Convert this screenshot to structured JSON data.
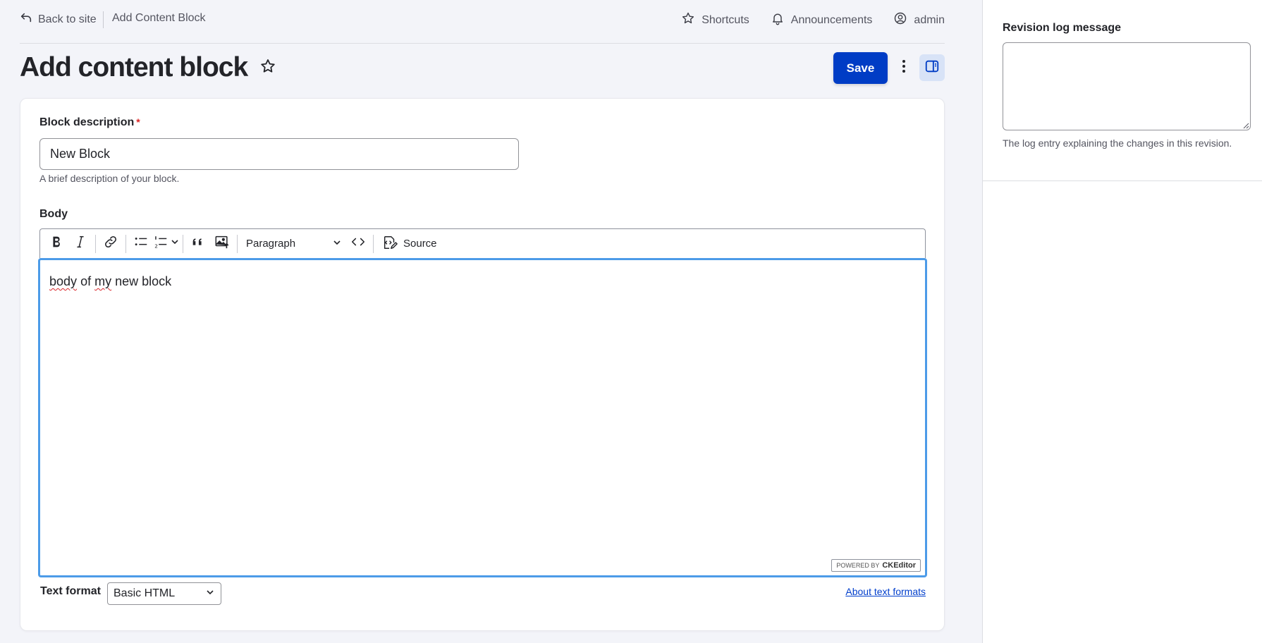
{
  "topbar": {
    "back_label": "Back to site",
    "breadcrumb": "Add Content Block",
    "shortcuts_label": "Shortcuts",
    "announcements_label": "Announcements",
    "user_label": "admin"
  },
  "page": {
    "title": "Add content block",
    "save_label": "Save"
  },
  "form": {
    "block_description": {
      "label": "Block description",
      "required_mark": "*",
      "value": "New Block",
      "help": "A brief description of your block."
    },
    "body": {
      "label": "Body",
      "heading_select": "Paragraph",
      "source_label": "Source",
      "content_words": [
        "body",
        "of",
        "my",
        "new block"
      ],
      "powered_by": "POWERED BY",
      "ckeditor_brand": "CKEditor"
    },
    "text_format": {
      "label": "Text format",
      "selected": "Basic HTML",
      "about_link": "About text formats"
    }
  },
  "sidebar": {
    "revision_log": {
      "label": "Revision log message",
      "value": "",
      "help": "The log entry explaining the changes in this revision."
    }
  },
  "colors": {
    "primary": "#003cc5",
    "focus_ring": "#4c9be8",
    "required": "#dc2323",
    "link": "#003ecc"
  }
}
